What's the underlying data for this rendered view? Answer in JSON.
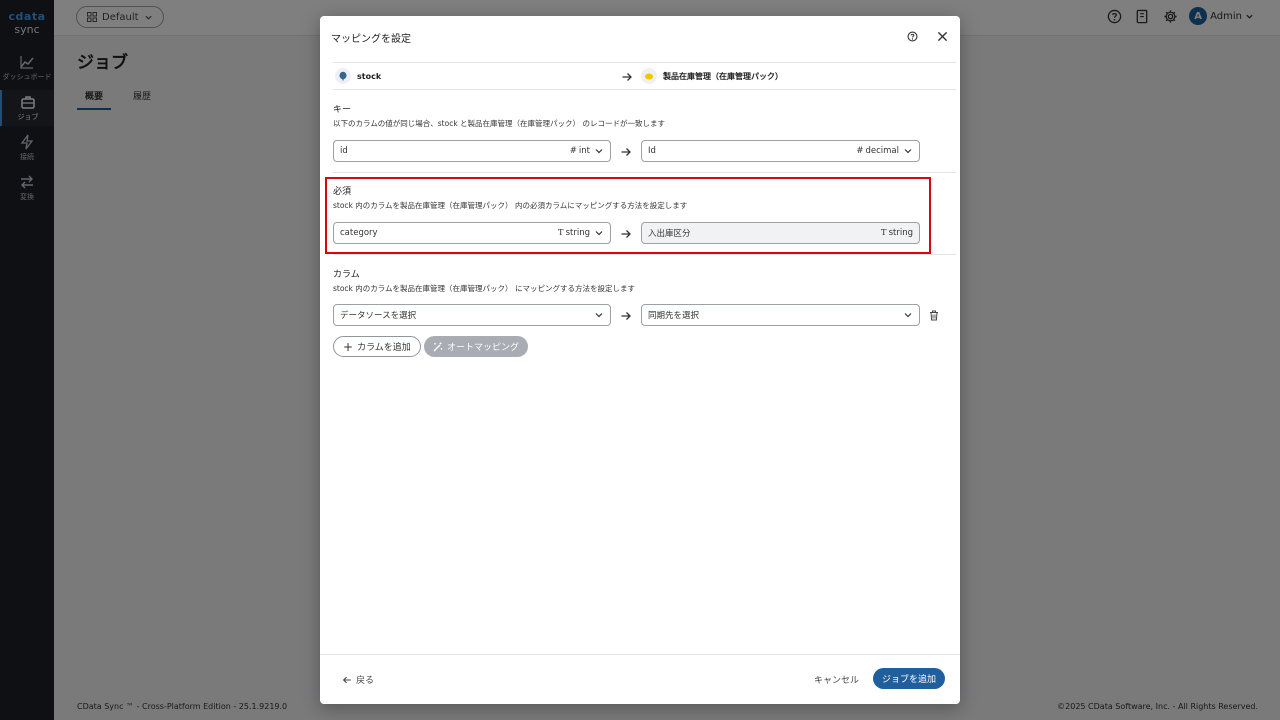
{
  "nav": {
    "brand": "cdata",
    "product": "sync",
    "items": [
      {
        "label": "ダッシュボード",
        "icon": "chart-icon"
      },
      {
        "label": "ジョブ",
        "icon": "briefcase-icon"
      },
      {
        "label": "接続",
        "icon": "bolt-icon"
      },
      {
        "label": "変換",
        "icon": "transform-icon"
      }
    ]
  },
  "topbar": {
    "workspace": "Default",
    "user_initial": "A",
    "user_name": "Admin"
  },
  "page": {
    "title": "ジョブ",
    "tabs": [
      "概要",
      "履歴"
    ]
  },
  "footer": {
    "left": "CData Sync ™ - Cross-Platform Edition - 25.1.9219.0",
    "right": "©2025 CData Software, Inc. - All Rights Reserved."
  },
  "modal": {
    "title": "マッピングを設定",
    "source": "stock",
    "destination": "製品在庫管理（在庫管理パック）",
    "key": {
      "title": "キー",
      "desc": "以下のカラムの値が同じ場合、stock と製品在庫管理（在庫管理パック） のレコードが一致します",
      "source_field": "id",
      "source_type": "int",
      "dest_field": "Id",
      "dest_type": "decimal"
    },
    "required": {
      "title": "必須",
      "desc": "stock 内のカラムを製品在庫管理（在庫管理パック） 内の必須カラムにマッピングする方法を設定します",
      "source_field": "category",
      "source_type": "string",
      "dest_field": "入出庫区分",
      "dest_type": "string"
    },
    "columns": {
      "title": "カラム",
      "desc": "stock 内のカラムを製品在庫管理（在庫管理パック） にマッピングする方法を設定します",
      "source_placeholder": "データソースを選択",
      "dest_placeholder": "同期先を選択",
      "add_label": "カラムを追加",
      "auto_label": "オートマッピング"
    },
    "back_label": "戻る",
    "cancel_label": "キャンセル",
    "submit_label": "ジョブを追加"
  },
  "colors": {
    "primary": "#1f5f9e",
    "highlight": "#d40b0b",
    "nav_bg": "#1d2127"
  }
}
